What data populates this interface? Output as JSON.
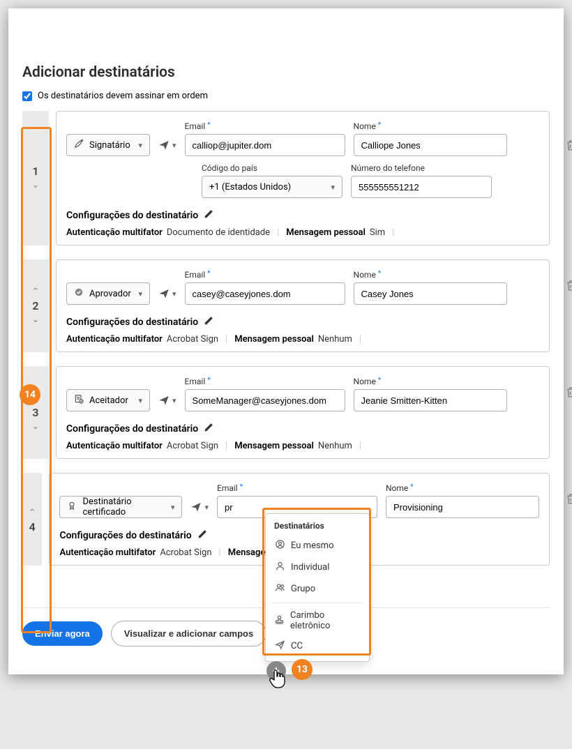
{
  "title": "Adicionar destinatários",
  "orderCheckbox": "Os destinatários devem assinar em ordem",
  "labels": {
    "email": "Email",
    "name": "Nome",
    "country": "Código do país",
    "phone": "Número do telefone",
    "config": "Configurações do destinatário",
    "auth": "Autenticação multifator",
    "msg": "Mensagem pessoal"
  },
  "recipients": [
    {
      "order": "1",
      "role": "Signatário",
      "email": "calliop@jupiter.dom",
      "name": "Calliope Jones",
      "country": "+1 (Estados Unidos)",
      "phone": "555555551212",
      "auth": "Documento de identidade",
      "msg": "Sim",
      "hasPhone": true,
      "arrows": "down"
    },
    {
      "order": "2",
      "role": "Aprovador",
      "email": "casey@caseyjones.dom",
      "name": "Casey Jones",
      "auth": "Acrobat Sign",
      "msg": "Nenhum",
      "hasPhone": false,
      "arrows": "both"
    },
    {
      "order": "3",
      "role": "Aceitador",
      "email": "SomeManager@caseyjones.dom",
      "name": "Jeanie Smitten-Kitten",
      "auth": "Acrobat Sign",
      "msg": "Nenhum",
      "hasPhone": false,
      "arrows": "both"
    },
    {
      "order": "4",
      "role": "Destinatário certificado",
      "email": "pr",
      "name": "Provisioning",
      "auth": "Acrobat Sign",
      "msg": "",
      "hasPhone": false,
      "arrows": "up",
      "roleCert": true,
      "msgTruncated": "Mensagem p"
    }
  ],
  "popup": {
    "title": "Destinatários",
    "items": [
      {
        "label": "Eu mesmo",
        "icon": "user-circle"
      },
      {
        "label": "Individual",
        "icon": "user"
      },
      {
        "label": "Grupo",
        "icon": "users"
      }
    ],
    "items2": [
      {
        "label": "Carimbo eletrônico",
        "icon": "stamp"
      },
      {
        "label": "CC",
        "icon": "send"
      }
    ]
  },
  "badge13": "13",
  "badge14": "14",
  "buttons": {
    "send": "Enviar agora",
    "preview": "Visualizar e adicionar campos"
  }
}
